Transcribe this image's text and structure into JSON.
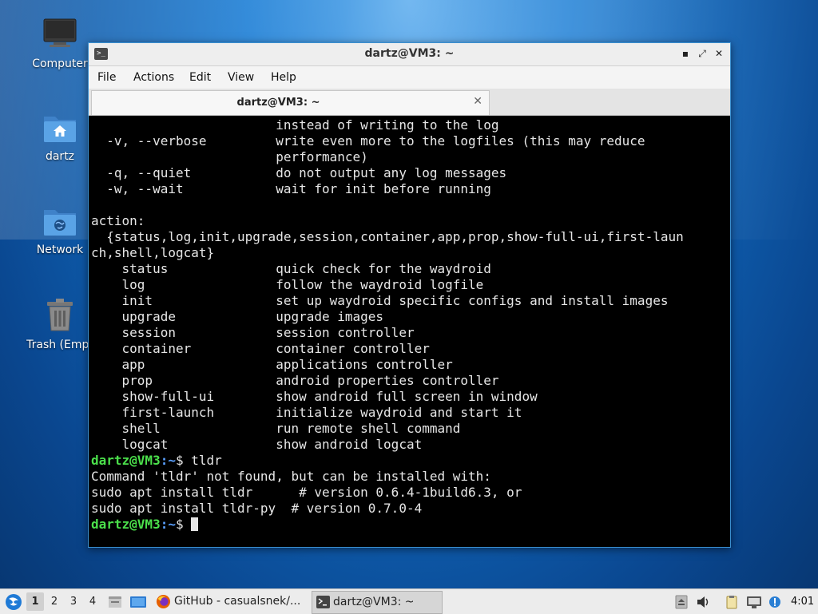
{
  "desktop": {
    "icons": [
      {
        "label": "Computer"
      },
      {
        "label": "dartz"
      },
      {
        "label": "Network"
      },
      {
        "label": "Trash (Empt"
      }
    ]
  },
  "window": {
    "title": "dartz@VM3: ~",
    "menu": [
      "File",
      "Actions",
      "Edit",
      "View",
      "Help"
    ],
    "tab_label": "dartz@VM3: ~",
    "controls": {
      "minimize": "▪",
      "maximize": "⤢",
      "close": "✕"
    }
  },
  "terminal": {
    "lines": [
      "                        instead of writing to the log",
      "  -v, --verbose         write even more to the logfiles (this may reduce",
      "                        performance)",
      "  -q, --quiet           do not output any log messages",
      "  -w, --wait            wait for init before running",
      "",
      "action:",
      "  {status,log,init,upgrade,session,container,app,prop,show-full-ui,first-laun",
      "ch,shell,logcat}",
      "    status              quick check for the waydroid",
      "    log                 follow the waydroid logfile",
      "    init                set up waydroid specific configs and install images",
      "    upgrade             upgrade images",
      "    session             session controller",
      "    container           container controller",
      "    app                 applications controller",
      "    prop                android properties controller",
      "    show-full-ui        show android full screen in window",
      "    first-launch        initialize waydroid and start it",
      "    shell               run remote shell command",
      "    logcat              show android logcat"
    ],
    "prompt_user": "dartz@VM3",
    "prompt_path": ":~",
    "prompt_symbol": "$ ",
    "command": "tldr",
    "output": [
      "Command 'tldr' not found, but can be installed with:",
      "sudo apt install tldr      # version 0.6.4-1build6.3, or",
      "sudo apt install tldr-py  # version 0.7.0-4"
    ]
  },
  "taskbar": {
    "workspaces": [
      "1",
      "2",
      "3",
      "4"
    ],
    "active_workspace": "1",
    "tasks": [
      {
        "label": "GitHub - casualsnek/...",
        "icon": "firefox-icon"
      },
      {
        "label": "dartz@VM3: ~",
        "icon": "terminal-icon"
      }
    ],
    "clock": "4:01"
  },
  "colors": {
    "prompt_user": "#4be04b",
    "prompt_path": "#5aa0ff",
    "accent": "#3a8fd0"
  }
}
